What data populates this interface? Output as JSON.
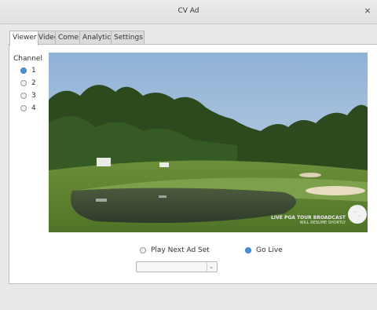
{
  "window": {
    "title": "CV Ad",
    "close_glyph": "×"
  },
  "tabs": [
    {
      "label": "Viewer",
      "active": true
    },
    {
      "label": "Video",
      "active": false
    },
    {
      "label": "Comer",
      "active": false
    },
    {
      "label": "Analytics",
      "active": false
    },
    {
      "label": "Settings",
      "active": false
    }
  ],
  "viewer": {
    "channel_label": "Channel",
    "channels": [
      {
        "label": "1",
        "selected": true
      },
      {
        "label": "2",
        "selected": false
      },
      {
        "label": "3",
        "selected": false
      },
      {
        "label": "4",
        "selected": false
      }
    ],
    "video": {
      "overlay_line1": "LIVE PGA TOUR BROADCAST",
      "overlay_line2": "WILL RESUME SHORTLY"
    },
    "mode_options": [
      {
        "label": "Play Next Ad Set",
        "selected": false
      },
      {
        "label": "Go Live",
        "selected": true
      }
    ],
    "ad_set_select": {
      "value": ""
    }
  },
  "colors": {
    "accent": "#4a90d9",
    "panel": "#ffffff",
    "window_bg": "#e8e8e7"
  }
}
